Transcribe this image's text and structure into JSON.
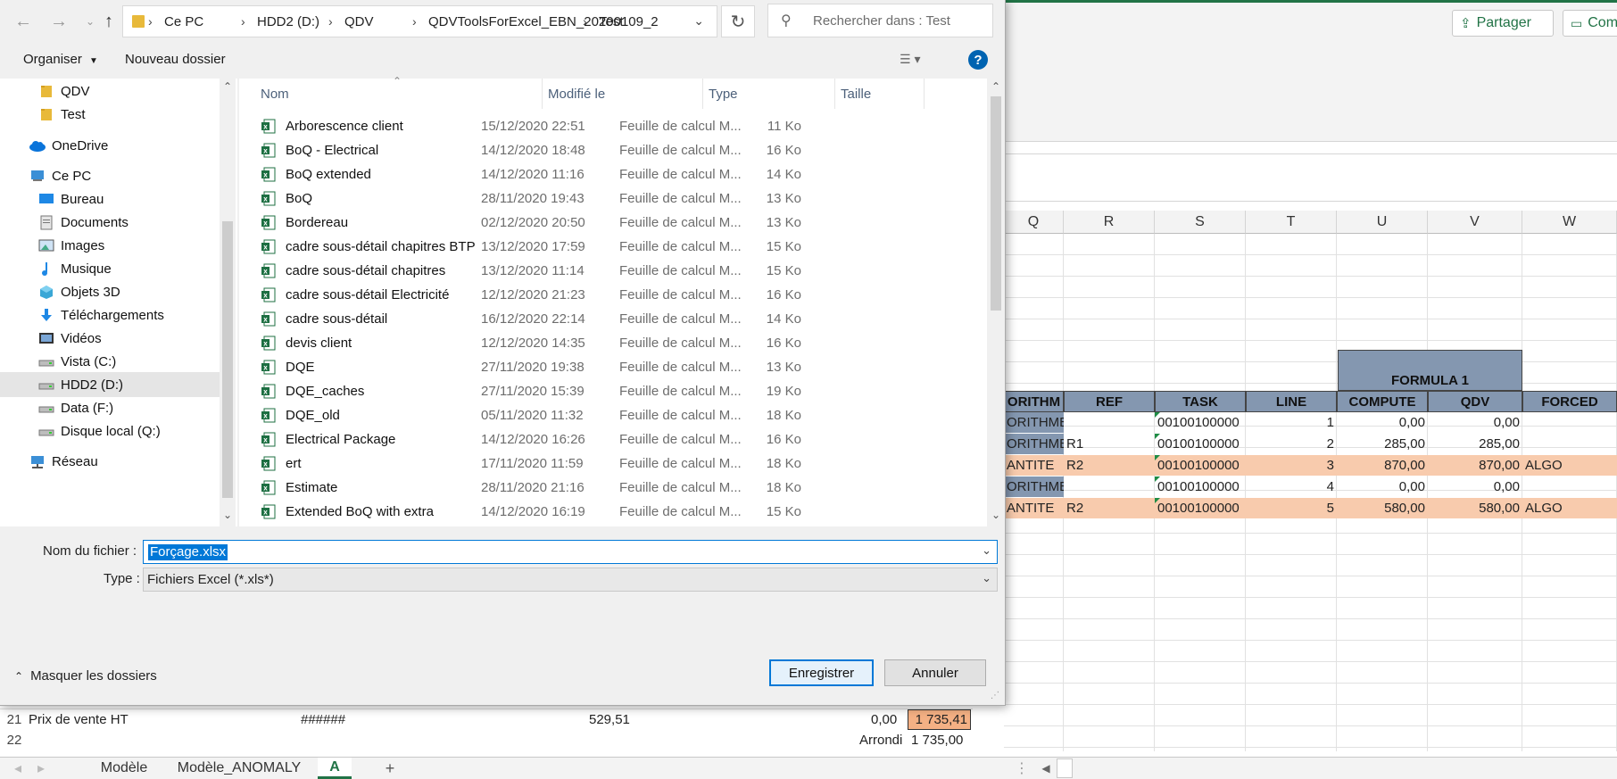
{
  "excel": {
    "ribbon_buttons": {
      "share": "Partager",
      "comments": "Com"
    },
    "column_headers": [
      "Q",
      "R",
      "S",
      "T",
      "U",
      "V",
      "W"
    ],
    "formula_header": "FORMULA 1",
    "table_headers": [
      "ORITHM",
      "REF",
      "TASK",
      "LINE",
      "COMPUTE",
      "QDV",
      "FORCED"
    ],
    "table_rows": [
      {
        "algo": "ORITHME",
        "ref": "",
        "task": "00100100000",
        "line": "1",
        "compute": "0,00",
        "qdv": "0,00",
        "forced": "",
        "highlight": false
      },
      {
        "algo": "ORITHME",
        "ref": "R1",
        "task": "00100100000",
        "line": "2",
        "compute": "285,00",
        "qdv": "285,00",
        "forced": "",
        "highlight": false
      },
      {
        "algo": "ANTITE",
        "ref": "R2",
        "task": "00100100000",
        "line": "3",
        "compute": "870,00",
        "qdv": "870,00",
        "forced": "ALGO",
        "highlight": true
      },
      {
        "algo": "ORITHME",
        "ref": "",
        "task": "00100100000",
        "line": "4",
        "compute": "0,00",
        "qdv": "0,00",
        "forced": "",
        "highlight": false
      },
      {
        "algo": "ANTITE",
        "ref": "R2",
        "task": "00100100000",
        "line": "5",
        "compute": "580,00",
        "qdv": "580,00",
        "forced": "ALGO",
        "highlight": true
      }
    ],
    "lower_rows": {
      "row21": {
        "num": "21",
        "label": "Prix de vente HT",
        "hash": "######",
        "v1": "529,51",
        "v2": "0,00",
        "v3": "1 735,41"
      },
      "row22": {
        "num": "22",
        "label": "Arrondi",
        "v3": "1 735,00"
      }
    },
    "sheet_tabs": [
      "Modèle",
      "Modèle_ANOMALY",
      "A"
    ],
    "active_tab": "A",
    "add_sheet": "+"
  },
  "dialog": {
    "breadcrumb": [
      "Ce PC",
      "HDD2 (D:)",
      "QDV",
      "QDVToolsForExcel_EBN_20200109_2",
      "Test"
    ],
    "search_placeholder": "Rechercher dans : Test",
    "toolbar": {
      "organize": "Organiser",
      "new_folder": "Nouveau dossier"
    },
    "nav_items": [
      {
        "label": "QDV",
        "icon": "folder-icon"
      },
      {
        "label": "Test",
        "icon": "folder-icon"
      },
      {
        "label": "OneDrive",
        "icon": "cloud-icon"
      },
      {
        "label": "Ce PC",
        "icon": "computer-icon"
      },
      {
        "label": "Bureau",
        "icon": "desktop-icon"
      },
      {
        "label": "Documents",
        "icon": "documents-icon"
      },
      {
        "label": "Images",
        "icon": "images-icon"
      },
      {
        "label": "Musique",
        "icon": "music-icon"
      },
      {
        "label": "Objets 3D",
        "icon": "cube-icon"
      },
      {
        "label": "Téléchargements",
        "icon": "download-icon"
      },
      {
        "label": "Vidéos",
        "icon": "video-icon"
      },
      {
        "label": "Vista (C:)",
        "icon": "drive-icon"
      },
      {
        "label": "HDD2 (D:)",
        "icon": "drive-icon"
      },
      {
        "label": "Data (F:)",
        "icon": "drive-icon"
      },
      {
        "label": "Disque local (Q:)",
        "icon": "drive-icon"
      },
      {
        "label": "Réseau",
        "icon": "network-icon"
      }
    ],
    "selected_nav": "HDD2 (D:)",
    "columns": [
      "Nom",
      "Modifié le",
      "Type",
      "Taille"
    ],
    "files": [
      {
        "name": "Arborescence client",
        "date": "15/12/2020 22:51",
        "type": "Feuille de calcul M...",
        "size": "11 Ko"
      },
      {
        "name": "BoQ - Electrical",
        "date": "14/12/2020 18:48",
        "type": "Feuille de calcul M...",
        "size": "16 Ko"
      },
      {
        "name": "BoQ extended",
        "date": "14/12/2020 11:16",
        "type": "Feuille de calcul M...",
        "size": "14 Ko"
      },
      {
        "name": "BoQ",
        "date": "28/11/2020 19:43",
        "type": "Feuille de calcul M...",
        "size": "13 Ko"
      },
      {
        "name": "Bordereau",
        "date": "02/12/2020 20:50",
        "type": "Feuille de calcul M...",
        "size": "13 Ko"
      },
      {
        "name": "cadre sous-détail chapitres BTP",
        "date": "13/12/2020 17:59",
        "type": "Feuille de calcul M...",
        "size": "15 Ko"
      },
      {
        "name": "cadre sous-détail chapitres",
        "date": "13/12/2020 11:14",
        "type": "Feuille de calcul M...",
        "size": "15 Ko"
      },
      {
        "name": "cadre sous-détail Electricité",
        "date": "12/12/2020 21:23",
        "type": "Feuille de calcul M...",
        "size": "16 Ko"
      },
      {
        "name": "cadre sous-détail",
        "date": "16/12/2020 22:14",
        "type": "Feuille de calcul M...",
        "size": "14 Ko"
      },
      {
        "name": "devis client",
        "date": "12/12/2020 14:35",
        "type": "Feuille de calcul M...",
        "size": "16 Ko"
      },
      {
        "name": "DQE",
        "date": "27/11/2020 19:38",
        "type": "Feuille de calcul M...",
        "size": "13 Ko"
      },
      {
        "name": "DQE_caches",
        "date": "27/11/2020 15:39",
        "type": "Feuille de calcul M...",
        "size": "19 Ko"
      },
      {
        "name": "DQE_old",
        "date": "05/11/2020 11:32",
        "type": "Feuille de calcul M...",
        "size": "18 Ko"
      },
      {
        "name": "Electrical Package",
        "date": "14/12/2020 16:26",
        "type": "Feuille de calcul M...",
        "size": "16 Ko"
      },
      {
        "name": "ert",
        "date": "17/11/2020 11:59",
        "type": "Feuille de calcul M...",
        "size": "18 Ko"
      },
      {
        "name": "Estimate",
        "date": "28/11/2020 21:16",
        "type": "Feuille de calcul M...",
        "size": "18 Ko"
      },
      {
        "name": "Extended BoQ with extra",
        "date": "14/12/2020 16:19",
        "type": "Feuille de calcul M...",
        "size": "15 Ko"
      }
    ],
    "filename_label": "Nom du fichier :",
    "filename_value": "Forçage.xlsx",
    "type_label": "Type :",
    "type_value": "Fichiers Excel (*.xls*)",
    "hide_folders": "Masquer les dossiers",
    "save_button": "Enregistrer",
    "cancel_button": "Annuler",
    "help": "?"
  },
  "colors": {
    "accent": "#0078d7",
    "excel_green": "#217346",
    "header_blue": "#8497b0",
    "peach": "#f8cbad",
    "orange_cell": "#f4b084"
  }
}
